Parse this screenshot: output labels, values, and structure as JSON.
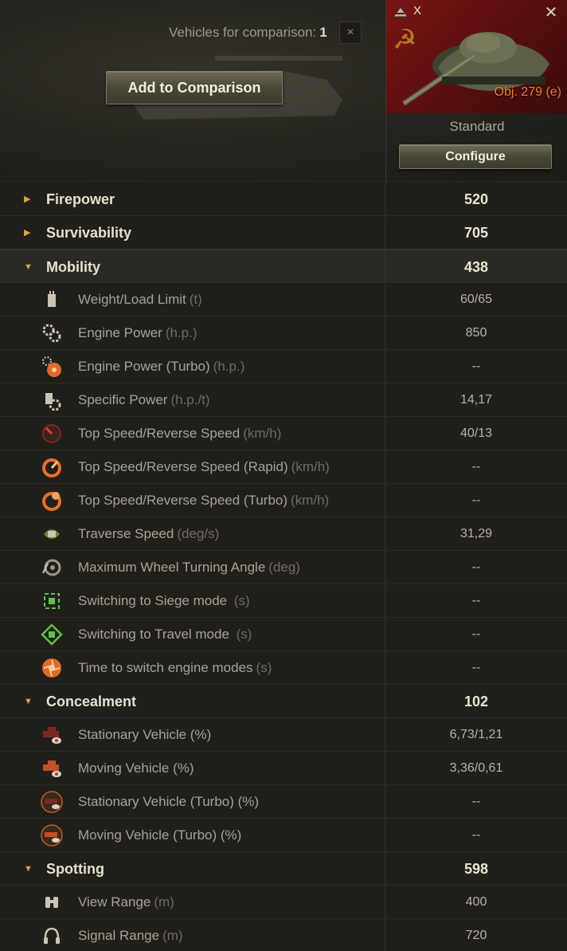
{
  "header": {
    "count_label": "Vehicles for comparison:",
    "count_value": "1",
    "clear_label": "×",
    "add_button": "Add to Comparison"
  },
  "vehicle": {
    "tier": "X",
    "name": "Obj. 279 (e)",
    "configuration": "Standard",
    "configure_button": "Configure",
    "close_label": "✕",
    "name_color": "#f08030"
  },
  "categories": {
    "firepower": {
      "label": "Firepower",
      "value": "520"
    },
    "survivability": {
      "label": "Survivability",
      "value": "705"
    },
    "mobility": {
      "label": "Mobility",
      "value": "438"
    },
    "concealment": {
      "label": "Concealment",
      "value": "102"
    },
    "spotting": {
      "label": "Spotting",
      "value": "598"
    }
  },
  "mobility_params": [
    {
      "icon": "weight-icon",
      "label": "Weight/Load Limit",
      "unit": "(t)",
      "value": "60/65"
    },
    {
      "icon": "engine-power-icon",
      "label": "Engine Power",
      "unit": "(h.p.)",
      "value": "850"
    },
    {
      "icon": "engine-turbo-icon",
      "label": "Engine Power (Turbo)",
      "unit": "(h.p.)",
      "value": "--"
    },
    {
      "icon": "specific-power-icon",
      "label": "Specific Power",
      "unit": "(h.p./t)",
      "value": "14,17"
    },
    {
      "icon": "speed-icon",
      "label": "Top Speed/Reverse Speed",
      "unit": "(km/h)",
      "value": "40/13"
    },
    {
      "icon": "speed-rapid-icon",
      "label": "Top Speed/Reverse Speed (Rapid)",
      "unit": "(km/h)",
      "value": "--"
    },
    {
      "icon": "speed-turbo-icon",
      "label": "Top Speed/Reverse Speed (Turbo)",
      "unit": "(km/h)",
      "value": "--"
    },
    {
      "icon": "traverse-icon",
      "label": "Traverse Speed",
      "unit": "(deg/s)",
      "value": "31,29"
    },
    {
      "icon": "wheel-angle-icon",
      "label": "Maximum Wheel Turning Angle",
      "unit": "(deg)",
      "value": "--"
    },
    {
      "icon": "siege-mode-icon",
      "label": "Switching to Siege mode",
      "unit": " (s)",
      "value": "--"
    },
    {
      "icon": "travel-mode-icon",
      "label": "Switching to Travel mode",
      "unit": " (s)",
      "value": "--"
    },
    {
      "icon": "engine-mode-icon",
      "label": "Time to switch engine modes",
      "unit": "(s)",
      "value": "--"
    }
  ],
  "concealment_params": [
    {
      "icon": "stationary-camo-icon",
      "label": "Stationary Vehicle (%)",
      "unit": "",
      "value": "6,73/1,21"
    },
    {
      "icon": "moving-camo-icon",
      "label": "Moving Vehicle (%)",
      "unit": "",
      "value": "3,36/0,61"
    },
    {
      "icon": "stationary-turbo-camo-icon",
      "label": "Stationary Vehicle (Turbo) (%)",
      "unit": "",
      "value": "--"
    },
    {
      "icon": "moving-turbo-camo-icon",
      "label": "Moving Vehicle (Turbo) (%)",
      "unit": "",
      "value": "--"
    }
  ],
  "spotting_params": [
    {
      "icon": "binoculars-icon",
      "label": "View Range",
      "unit": "(m)",
      "value": "400"
    },
    {
      "icon": "radio-icon",
      "label": "Signal Range",
      "unit": "(m)",
      "value": "720"
    }
  ]
}
